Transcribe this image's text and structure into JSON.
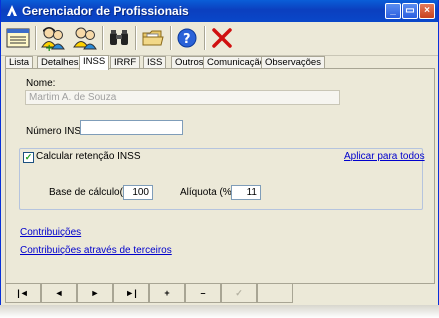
{
  "window": {
    "title": "Gerenciador de Profissionais"
  },
  "titlebar_buttons": [
    {
      "name": "minimize-button",
      "glyph": "_"
    },
    {
      "name": "restore-button",
      "glyph": "▭"
    },
    {
      "name": "close-button",
      "glyph": "×"
    }
  ],
  "toolbar": [
    {
      "name": "list-view-icon"
    },
    {
      "name": "add-user-icon"
    },
    {
      "name": "users-icon"
    },
    {
      "name": "binoculars-icon"
    },
    {
      "name": "folder-icon"
    },
    {
      "name": "help-icon"
    },
    {
      "name": "delete-icon"
    }
  ],
  "tabs": [
    "Lista",
    "Detalhes",
    "INSS",
    "IRRF",
    "ISS",
    "Outros",
    "Comunicação",
    "Observações"
  ],
  "active_tab": "INSS",
  "form": {
    "nome_label": "Nome:",
    "nome_value": "Martim A. de Souza",
    "numero_inss_label": "Número INSS:",
    "numero_inss_value": "",
    "calcular_label": "Calcular retenção INSS",
    "calcular_checked": true,
    "aplicar_link": "Aplicar para todos",
    "base_label": "Base de cálculo(%):",
    "base_value": "100",
    "aliquota_label": "Alíquota (%):",
    "aliquota_value": "11",
    "contribuicoes_link": "Contribuições",
    "contribuicoes_terceiros_link": "Contribuições através de terceiros"
  },
  "navigator": [
    {
      "name": "first-record-button",
      "glyph": "|◄",
      "enabled": true
    },
    {
      "name": "prior-record-button",
      "glyph": "◄",
      "enabled": true
    },
    {
      "name": "next-record-button",
      "glyph": "►",
      "enabled": true
    },
    {
      "name": "last-record-button",
      "glyph": "►|",
      "enabled": true
    },
    {
      "name": "insert-record-button",
      "glyph": "+",
      "enabled": true
    },
    {
      "name": "delete-record-button",
      "glyph": "–",
      "enabled": true
    },
    {
      "name": "post-record-button",
      "glyph": "✓",
      "enabled": false
    },
    {
      "name": "cancel-record-button",
      "glyph": "",
      "enabled": false
    }
  ],
  "colors": {
    "titlebar": "#0b3fbf",
    "window_bg": "#ece9d8",
    "link": "#0000cc",
    "check": "#21a121"
  }
}
